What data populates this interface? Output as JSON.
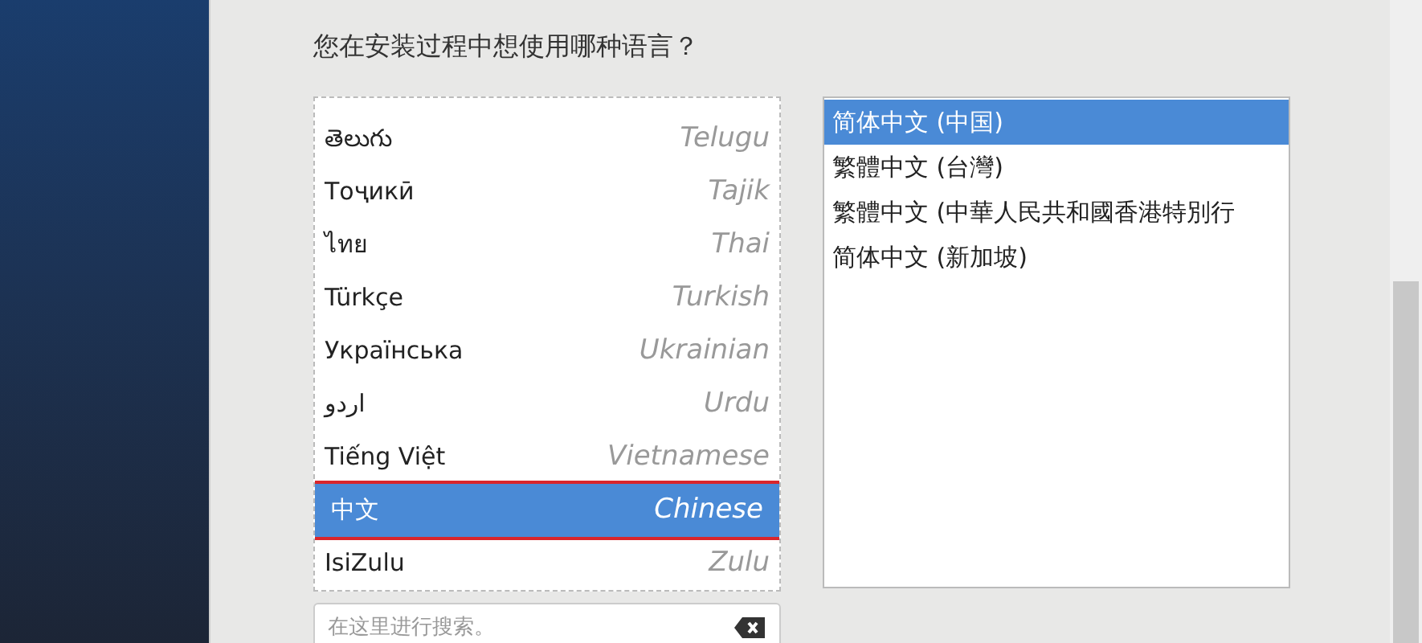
{
  "question": "您在安装过程中想使用哪种语言？",
  "languages": [
    {
      "native": "తెలుగు",
      "english": "Telugu",
      "selected": false
    },
    {
      "native": "Тоҷикӣ",
      "english": "Tajik",
      "selected": false
    },
    {
      "native": "ไทย",
      "english": "Thai",
      "selected": false
    },
    {
      "native": "Türkçe",
      "english": "Turkish",
      "selected": false
    },
    {
      "native": "Українська",
      "english": "Ukrainian",
      "selected": false
    },
    {
      "native": "اردو",
      "english": "Urdu",
      "selected": false
    },
    {
      "native": "Tiếng Việt",
      "english": "Vietnamese",
      "selected": false
    },
    {
      "native": "中文",
      "english": "Chinese",
      "selected": true
    },
    {
      "native": "IsiZulu",
      "english": "Zulu",
      "selected": false
    }
  ],
  "locales": [
    {
      "label": "简体中文 (中国)",
      "selected": true
    },
    {
      "label": "繁體中文 (台灣)",
      "selected": false
    },
    {
      "label": "繁體中文 (中華人民共和國香港特別行",
      "selected": false
    },
    {
      "label": "简体中文 (新加坡)",
      "selected": false
    }
  ],
  "search": {
    "placeholder": "在这里进行搜索。"
  }
}
